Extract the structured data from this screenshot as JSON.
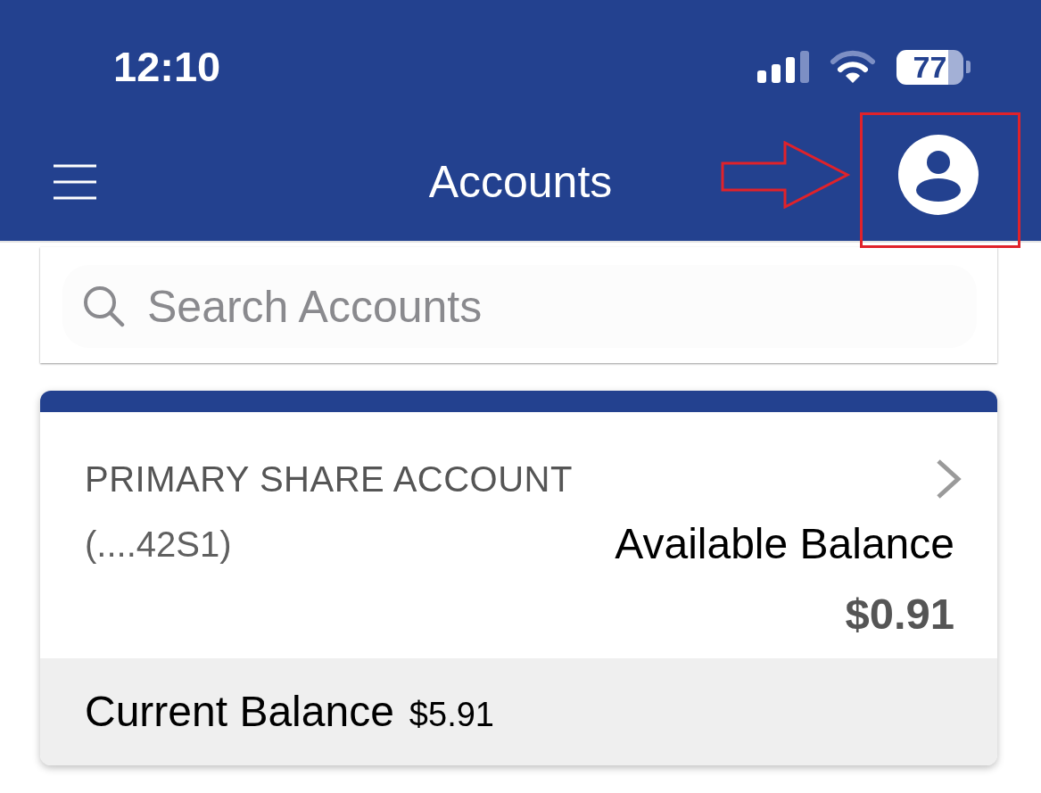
{
  "status_bar": {
    "time": "12:10",
    "battery": "77"
  },
  "nav_bar": {
    "title": "Accounts"
  },
  "search": {
    "placeholder": "Search Accounts"
  },
  "accounts": [
    {
      "name": "PRIMARY SHARE ACCOUNT",
      "number": "(....42S1)",
      "available_label": "Available Balance",
      "available_amount": "$0.91",
      "current_label": "Current Balance",
      "current_amount": "$5.91"
    }
  ]
}
